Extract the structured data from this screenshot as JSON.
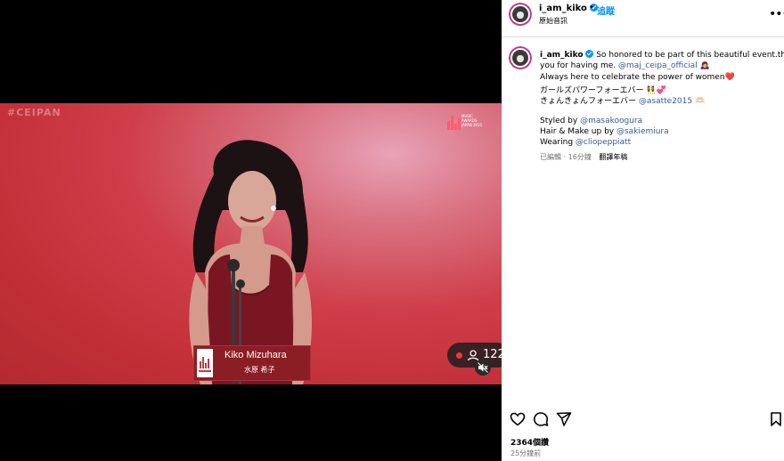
{
  "video": {
    "watermark": "#CEIPAN",
    "award_logo": "MUSIC AWARDS JAPAN 2025",
    "nameplate_name": "Kiko Mizuhara",
    "nameplate_jp": "水原 希子",
    "viewer_count": "122"
  },
  "post": {
    "username": "i_am_kiko",
    "follow_label": "追蹤",
    "sub": "原始音訊",
    "more_label": "•••"
  },
  "caption": {
    "line1_text": "So honored to be part of this beautiful event.thank",
    "line2_pre": "you for having me. ",
    "line2_link": "@maj_ceipa_official",
    "line2_emoji": "🙇‍♀️",
    "line3_text": "Always here to celebrate the power of women",
    "line3_emoji": "❤️",
    "line4_text": "ガールズパワーフォーエバー",
    "line4_emoji": "👯‍♀️💞",
    "line5_text": "きょんきょんフォーエバー ",
    "line5_link": "@asatte2015",
    "line5_emoji": "🫶🏻",
    "styled_label": "Styled by ",
    "styled_link": "@masakoogura",
    "hair_label": "Hair & Make up by ",
    "hair_link": "@sakiemiura",
    "wearing_label": "Wearing ",
    "wearing_link": "@cliopeppiatt",
    "edited": "已編輯 · 16分鐘",
    "translate": "翻譯年稿"
  },
  "actions": {
    "likes": "2364個讚",
    "time": "25分鐘前"
  },
  "colors": {
    "accent": "#0095f6",
    "live_red": "#ff3040",
    "stage": "#c22f37"
  },
  "icons": [
    "heart-icon",
    "comment-icon",
    "share-icon",
    "bookmark-icon",
    "mute-icon",
    "user-icon",
    "verified-icon",
    "more-icon"
  ]
}
